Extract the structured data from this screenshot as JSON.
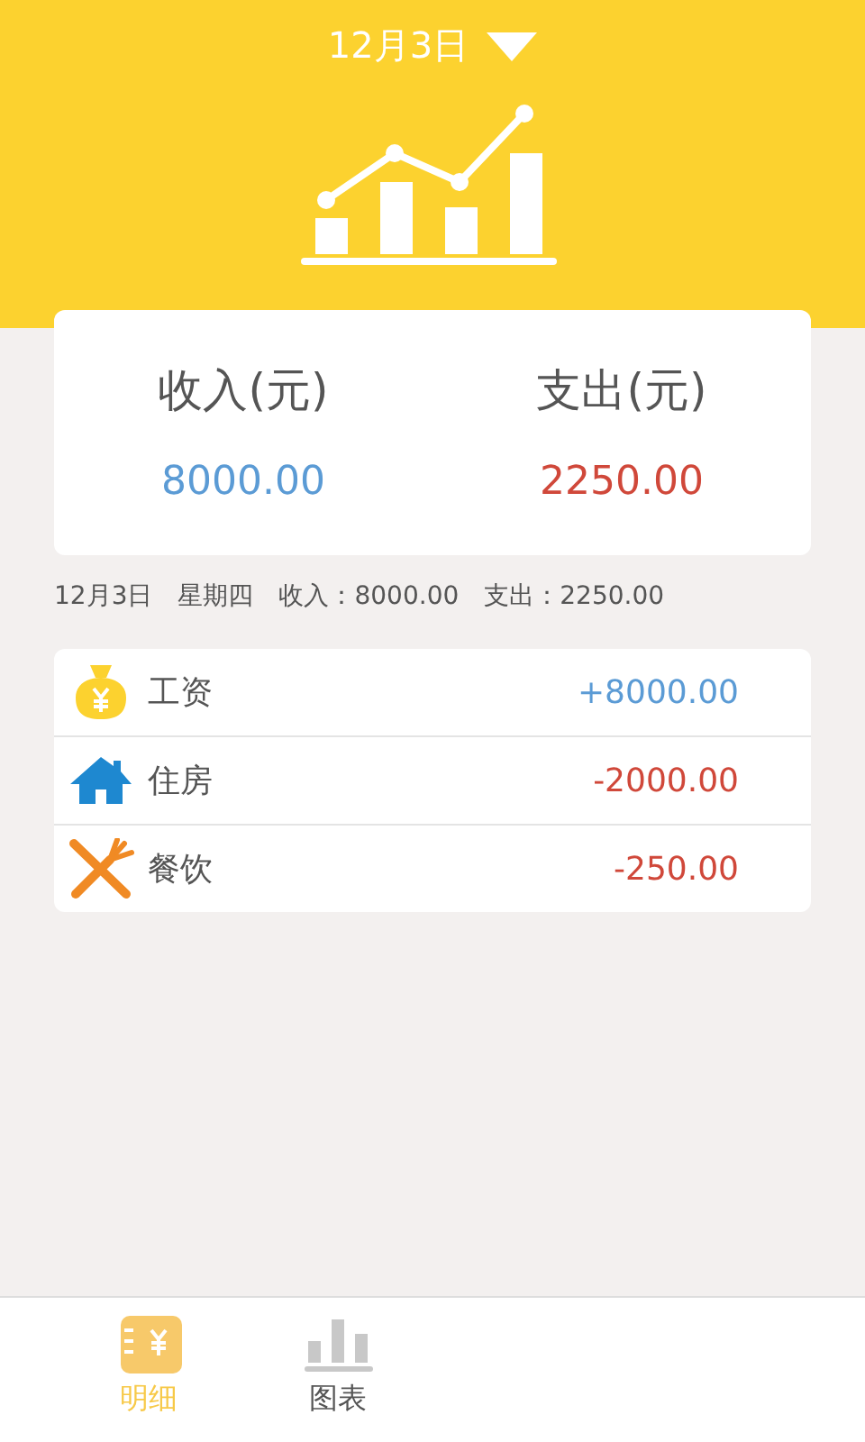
{
  "header": {
    "date": "12月3日"
  },
  "summary": [
    {
      "label": "收入(元)",
      "amount": "8000.00",
      "color": "#5b9bd5"
    },
    {
      "label": "支出(元)",
      "amount": "2250.00",
      "color": "#d0483a"
    }
  ],
  "day_line": {
    "date": "12月3日",
    "weekday": "星期四",
    "income": "收入：8000.00",
    "expense": "支出：2250.00"
  },
  "records": [
    {
      "kind": "salary",
      "name": "工资",
      "amount": "+8000.00",
      "color": "#5b9bd5"
    },
    {
      "kind": "housing",
      "name": "住房",
      "amount": "-2000.00",
      "color": "#d0483a"
    },
    {
      "kind": "dining",
      "name": "餐饮",
      "amount": "-250.00",
      "color": "#d0483a"
    }
  ],
  "tabs": [
    {
      "kind": "details",
      "label": "明细",
      "selected": true
    },
    {
      "kind": "chart",
      "label": "图表",
      "selected": false
    }
  ]
}
